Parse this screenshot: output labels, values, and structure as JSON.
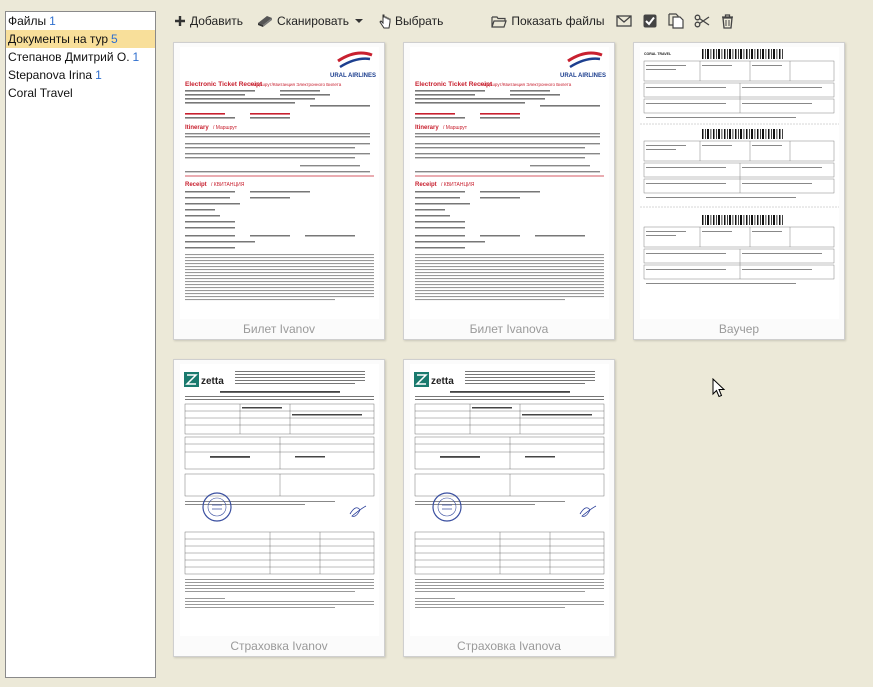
{
  "tree": {
    "items": [
      {
        "label": "Файлы",
        "count": "1"
      },
      {
        "label": "Документы на тур",
        "count": "5",
        "selected": true
      },
      {
        "label": "Степанов Дмитрий О.",
        "count": "1"
      },
      {
        "label": "Stepanova Irina",
        "count": "1"
      },
      {
        "label": "Coral Travel",
        "count": ""
      }
    ]
  },
  "toolbar": {
    "add_label": "Добавить",
    "scan_label": "Сканировать",
    "select_label": "Выбрать",
    "show_files_label": "Показать файлы"
  },
  "cards": [
    {
      "caption": "Билет Ivanov",
      "kind": "ticket",
      "doc": {
        "title": "Electronic Ticket Receipt",
        "title_ru": "/ Маршрут/Квитанция Электронного Билета",
        "brand": "URAL AIRLINES",
        "itinerary": "Itinerary",
        "itinerary_ru": "/ Маршрут",
        "receipt": "Receipt",
        "receipt_ru": "/ КВИТАНЦИЯ"
      }
    },
    {
      "caption": "Билет Ivanova",
      "kind": "ticket",
      "doc": {
        "title": "Electronic Ticket Receipt",
        "title_ru": "/ Маршрут/Квитанция Электронного Билета",
        "brand": "URAL AIRLINES",
        "itinerary": "Itinerary",
        "itinerary_ru": "/ Маршрут",
        "receipt": "Receipt",
        "receipt_ru": "/ КВИТАНЦИЯ"
      }
    },
    {
      "caption": "Ваучер",
      "kind": "voucher",
      "doc": {
        "brand": "CORAL TRAVEL"
      }
    },
    {
      "caption": "Страховка Ivanov",
      "kind": "insurance",
      "doc": {
        "brand": "zetta"
      }
    },
    {
      "caption": "Страховка Ivanova",
      "kind": "insurance",
      "doc": {
        "brand": "zetta"
      }
    }
  ],
  "colors": {
    "selected_bg": "#f8df9a",
    "count_blue": "#2f6fce",
    "ticket_red": "#c8202f",
    "ural_blue": "#1d3f8f"
  }
}
